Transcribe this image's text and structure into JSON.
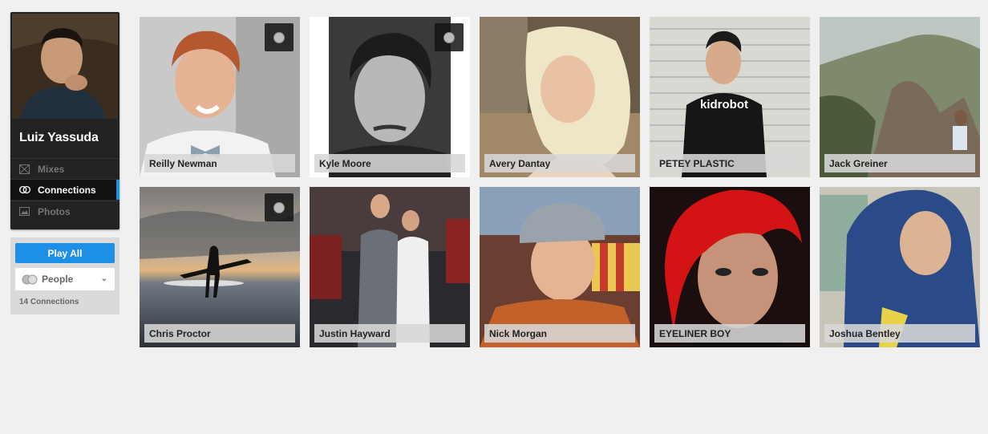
{
  "profile": {
    "name": "Luiz Yassuda",
    "nav": [
      {
        "label": "Mixes",
        "icon": "mixes-icon",
        "active": false
      },
      {
        "label": "Connections",
        "icon": "connections-icon",
        "active": true
      },
      {
        "label": "Photos",
        "icon": "photos-icon",
        "active": false
      }
    ]
  },
  "actions": {
    "play_all_label": "Play All",
    "filter_selected": "People",
    "connections_count": "14 Connections"
  },
  "colors": {
    "accent": "#1d8fe6",
    "sidebar_bg": "#222222",
    "page_bg": "#f0f0f0"
  },
  "connections": [
    {
      "name": "Reilly Newman",
      "follow_button": true
    },
    {
      "name": "Kyle Moore",
      "follow_button": true
    },
    {
      "name": "Avery Dantay",
      "follow_button": false
    },
    {
      "name": "PETEY PLASTIC",
      "follow_button": false
    },
    {
      "name": "Jack Greiner",
      "follow_button": false
    },
    {
      "name": "Chris Proctor",
      "follow_button": true
    },
    {
      "name": "Justin Hayward",
      "follow_button": false
    },
    {
      "name": "Nick Morgan",
      "follow_button": false
    },
    {
      "name": "EYELINER BOY",
      "follow_button": false
    },
    {
      "name": "Joshua Bentley",
      "follow_button": false
    }
  ]
}
